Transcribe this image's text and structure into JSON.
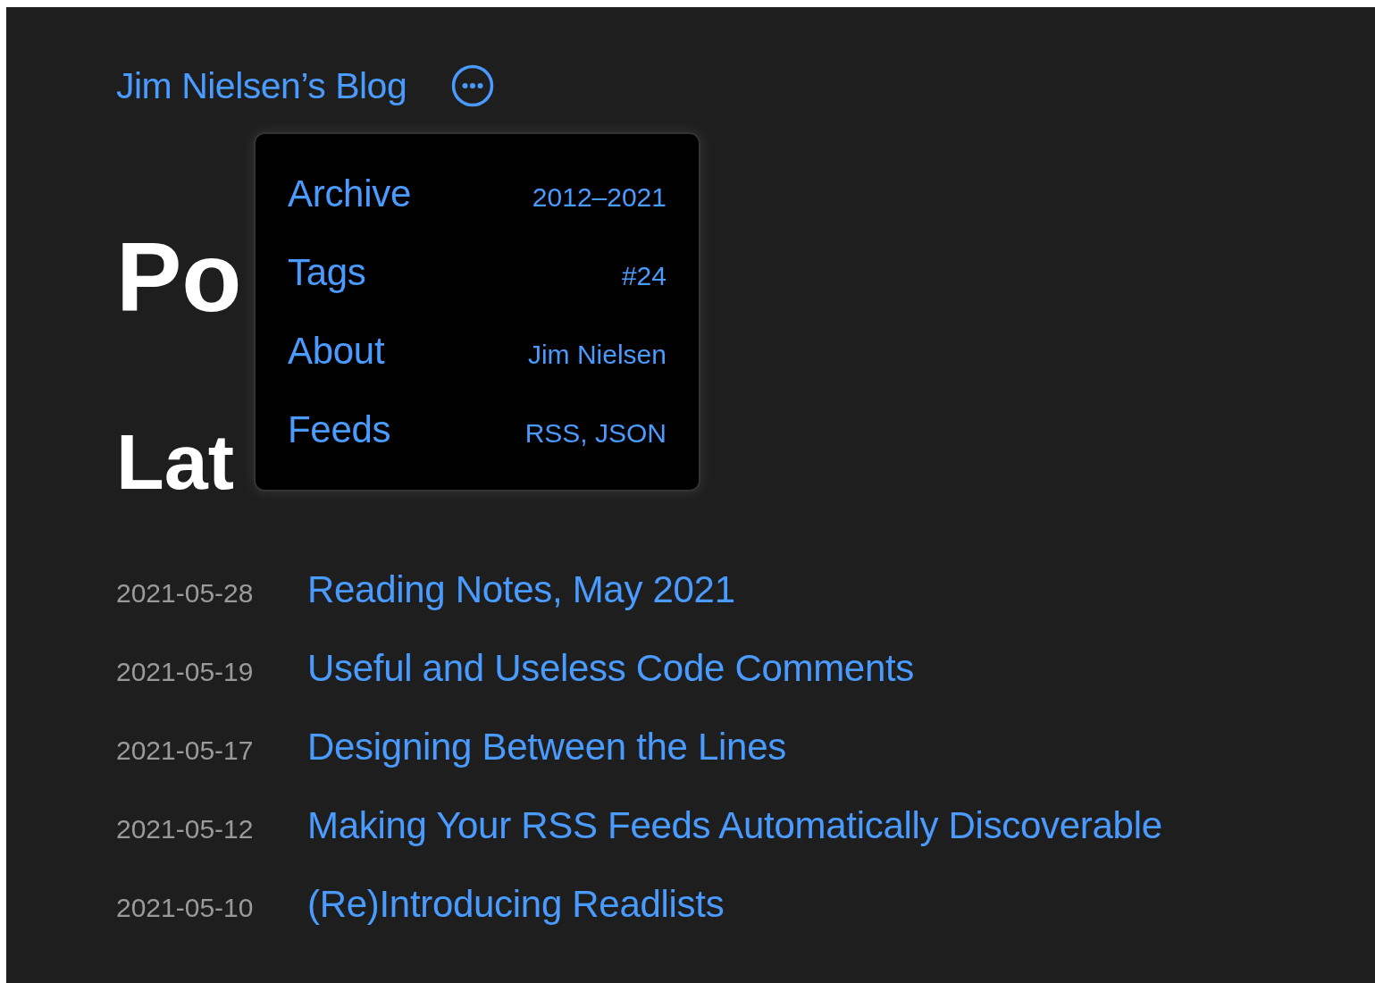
{
  "header": {
    "blog_title": "Jim Nielsen’s Blog"
  },
  "headings": [
    "Po",
    "Lat"
  ],
  "posts": [
    {
      "date": "2021-05-28",
      "title": "Reading Notes, May 2021"
    },
    {
      "date": "2021-05-19",
      "title": "Useful and Useless Code Comments"
    },
    {
      "date": "2021-05-17",
      "title": "Designing Between the Lines"
    },
    {
      "date": "2021-05-12",
      "title": "Making Your RSS Feeds Automatically Discoverable"
    },
    {
      "date": "2021-05-10",
      "title": "(Re)Introducing Readlists"
    }
  ],
  "menu": {
    "items": [
      {
        "label": "Archive",
        "detail": "2012–2021"
      },
      {
        "label": "Tags",
        "detail": "#24"
      },
      {
        "label": "About",
        "detail": "Jim Nielsen"
      },
      {
        "label": "Feeds",
        "detail": "RSS, JSON"
      }
    ]
  }
}
